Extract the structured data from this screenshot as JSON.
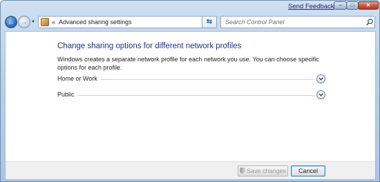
{
  "titlebar": {
    "feedback_link": "Send Feedback",
    "minimize_glyph": "–",
    "maximize_glyph": "□",
    "close_glyph": "✕"
  },
  "nav": {
    "back_glyph": "←",
    "forward_glyph": "→",
    "address": {
      "icon": "control-panel-icon",
      "chevron": "«",
      "path": "Advanced sharing settings"
    },
    "refresh_icon": "refresh-icon",
    "search": {
      "placeholder": "Search Control Panel",
      "icon": "search-icon"
    }
  },
  "main": {
    "heading": "Change sharing options for different network profiles",
    "description": "Windows creates a separate network profile for each network you use. You can choose specific options for each profile.",
    "profiles": [
      {
        "label": "Home or Work",
        "expander_icon": "chevron-down-icon"
      },
      {
        "label": "Public",
        "expander_icon": "chevron-down-icon"
      }
    ]
  },
  "buttons": {
    "save_label": "Save changes",
    "save_enabled": false,
    "cancel_label": "Cancel"
  },
  "colors": {
    "heading": "#1e3287",
    "frame": "#b9d1ea",
    "close_button": "#c75a45"
  }
}
